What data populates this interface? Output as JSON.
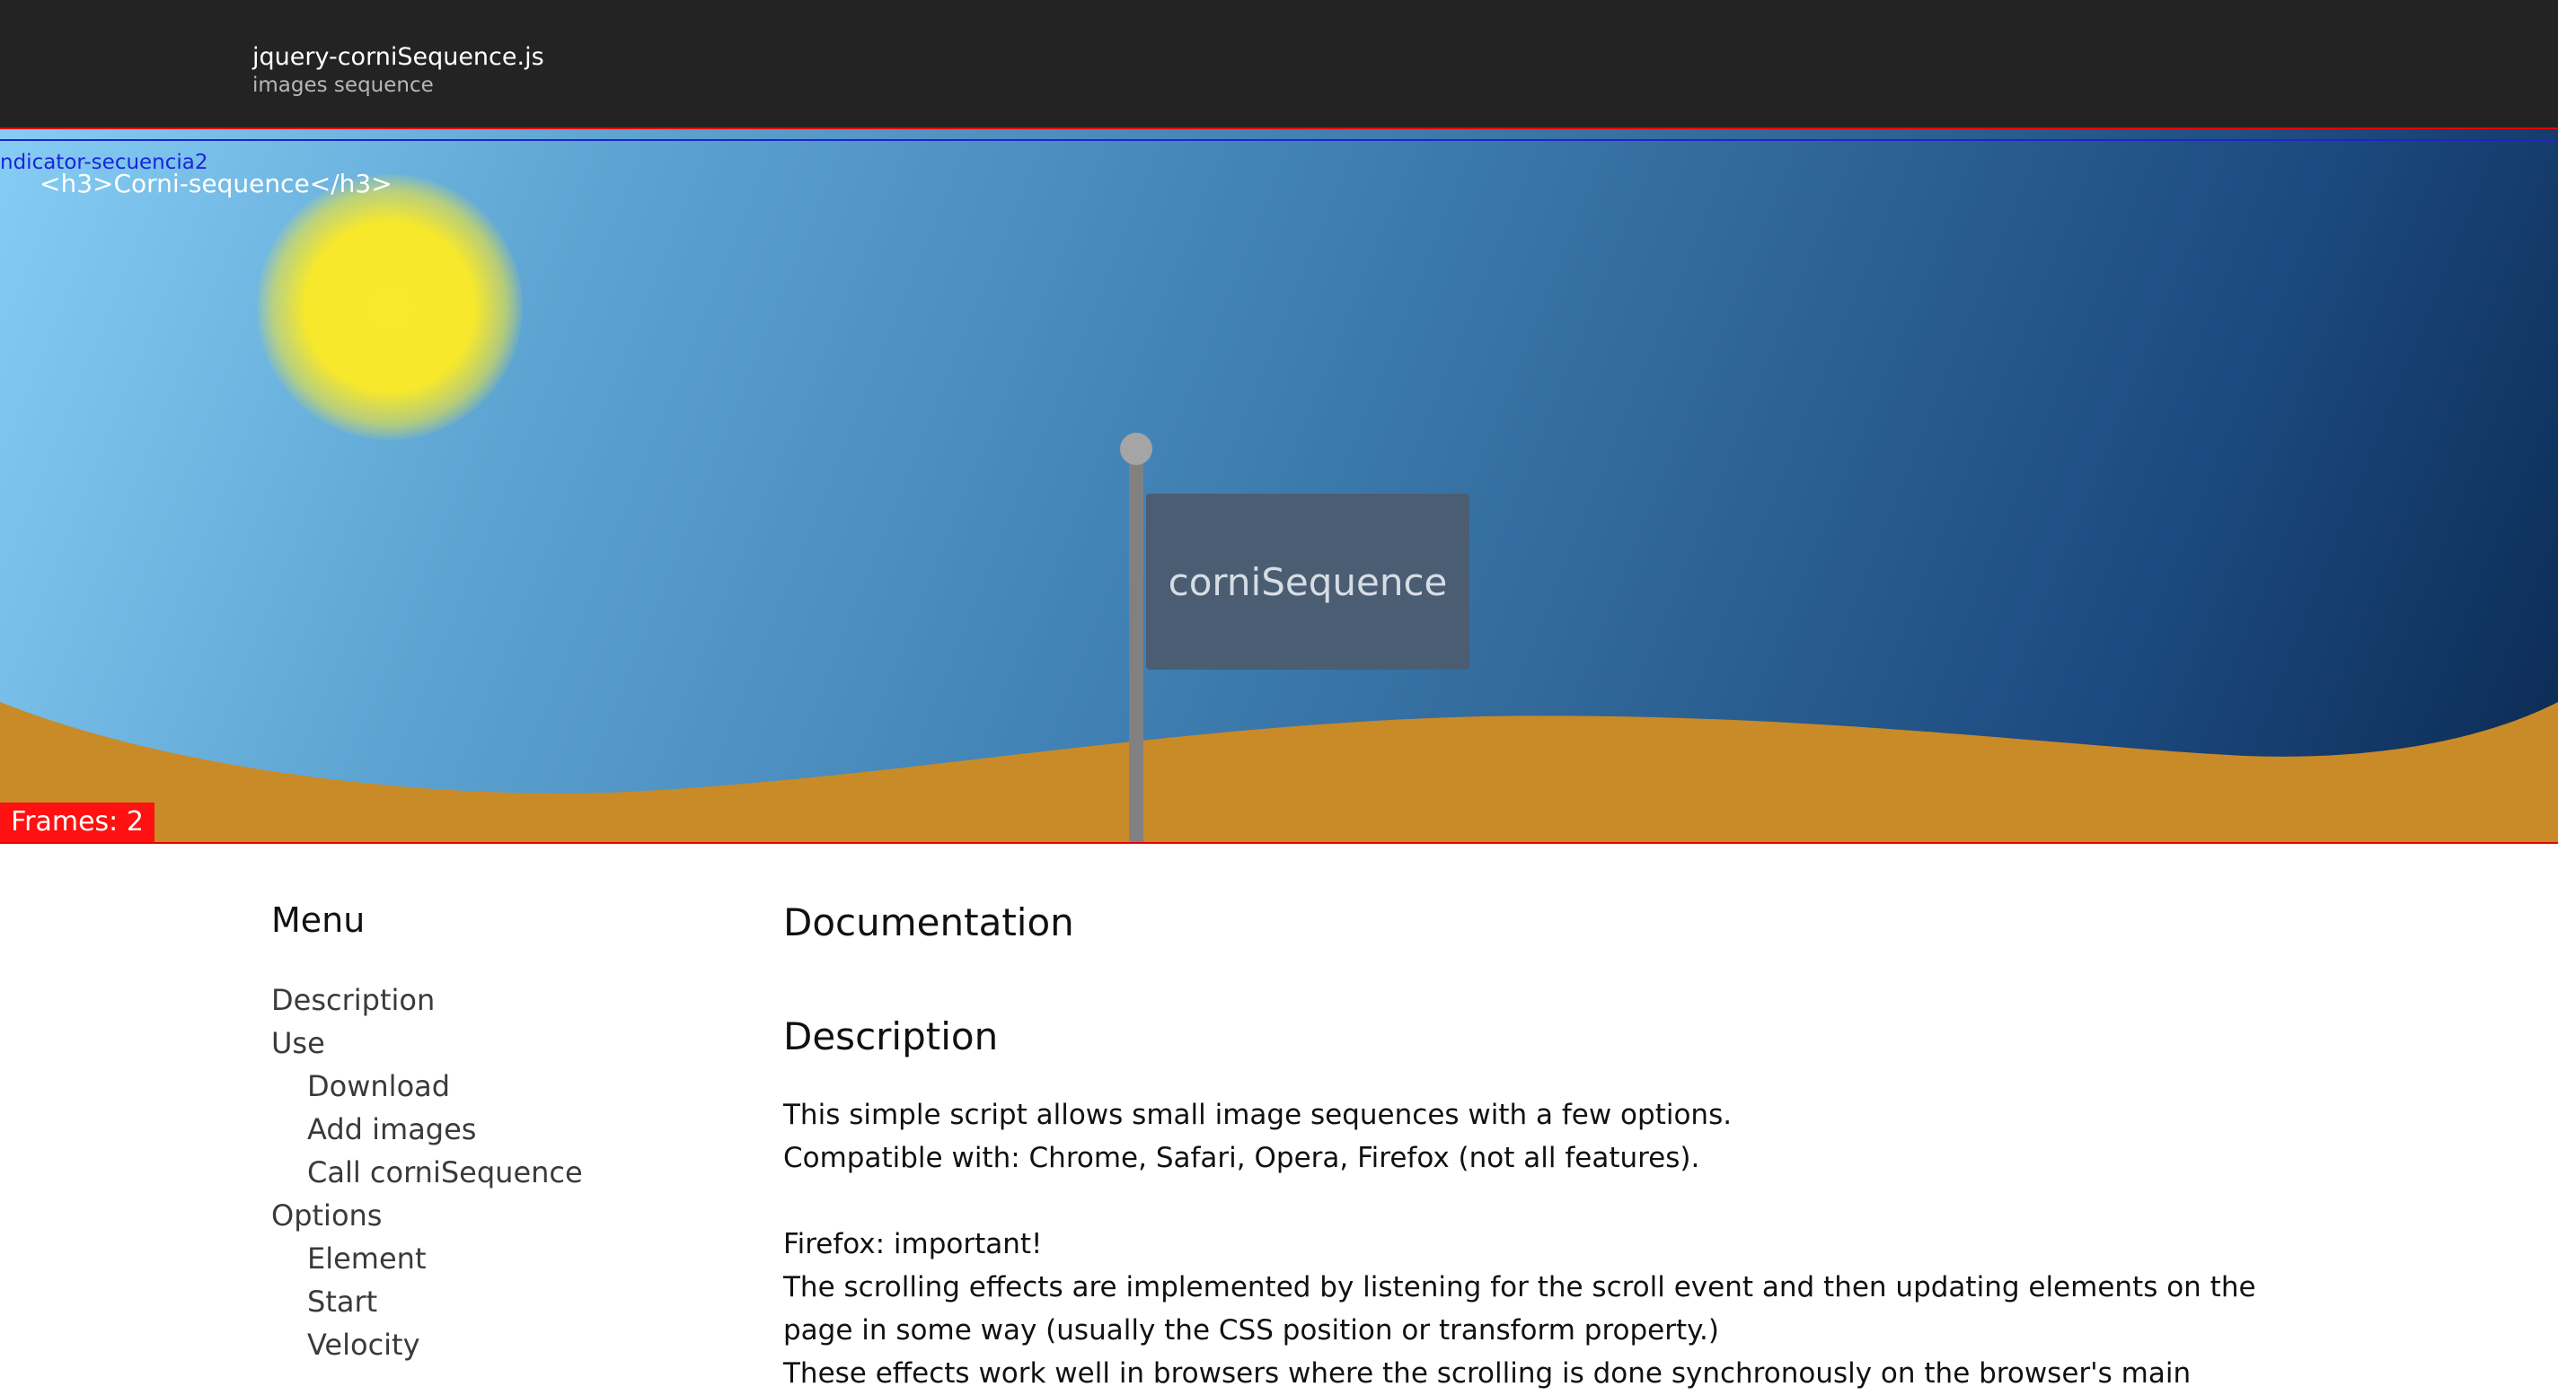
{
  "header": {
    "title": "jquery-corniSequence.js",
    "subtitle": "images sequence"
  },
  "hero": {
    "indicator_label": "ndicator-secuencia2",
    "heading_code": "<h3>Corni-sequence</h3>",
    "flag_text": "corniSequence",
    "frames_label": "Frames: 2",
    "colors": {
      "ground": "#c98a28",
      "sun": "#f6ea2a",
      "frames_badge": "#ff1111",
      "indicator": "#1c24d8"
    }
  },
  "sidebar": {
    "title": "Menu",
    "items": [
      {
        "label": "Description",
        "level": 0
      },
      {
        "label": "Use",
        "level": 0
      },
      {
        "label": "Download",
        "level": 1
      },
      {
        "label": "Add images",
        "level": 1
      },
      {
        "label": "Call corniSequence",
        "level": 1
      },
      {
        "label": "Options",
        "level": 0
      },
      {
        "label": "Element",
        "level": 1
      },
      {
        "label": "Start",
        "level": 1
      },
      {
        "label": "Velocity",
        "level": 1
      }
    ]
  },
  "main": {
    "title": "Documentation",
    "section_title": "Description",
    "intro": "This simple script allows small image sequences with a few options.",
    "compat": "Compatible with: Chrome, Safari, Opera, Firefox (not all features).",
    "firefox_label": "Firefox",
    "firefox_suffix": ": important!",
    "para1": "The scrolling effects are implemented by listening for the scroll event and then updating elements on the page in some way (usually the CSS position or transform property.)",
    "para2": "These effects work well in browsers where the scrolling is done synchronously on the browser's main"
  }
}
